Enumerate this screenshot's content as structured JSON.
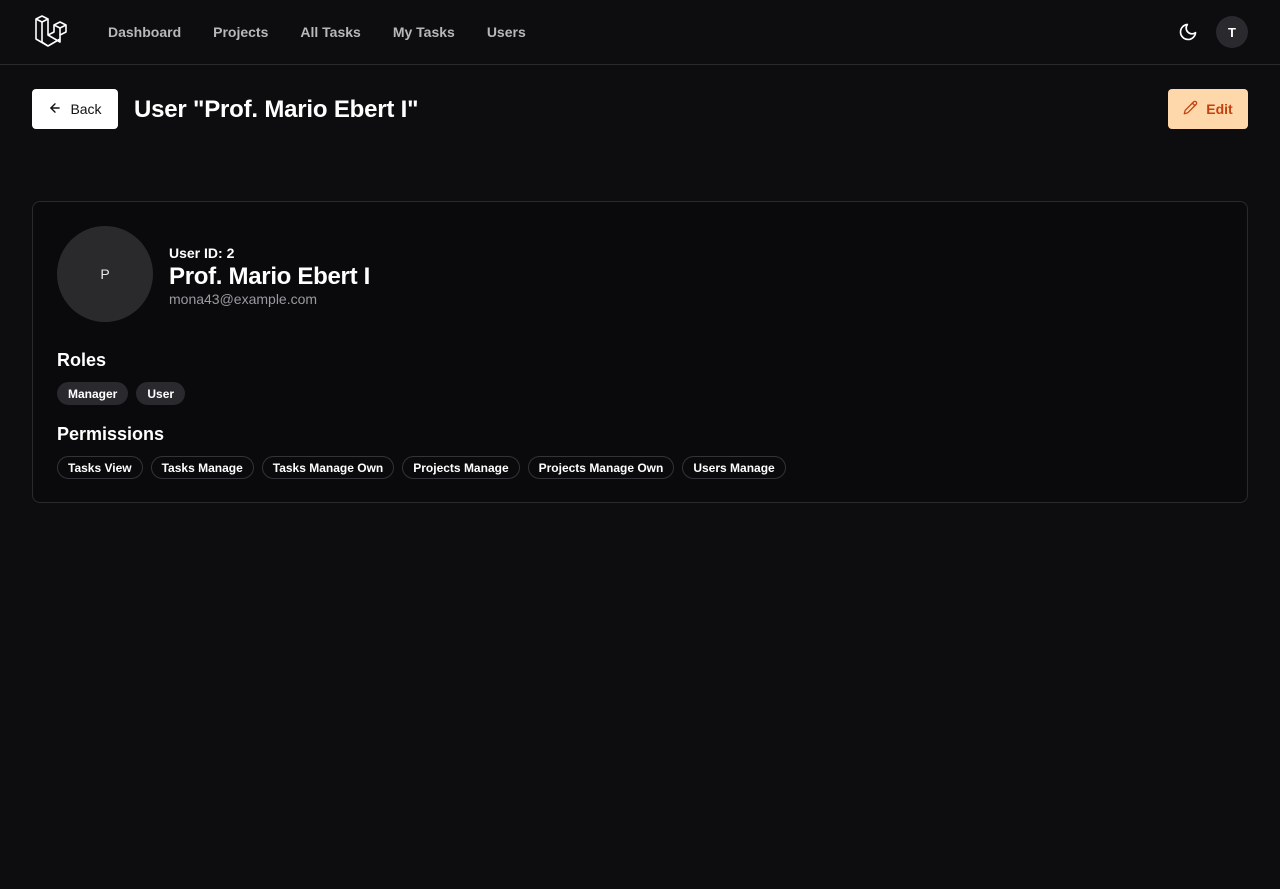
{
  "nav": {
    "items": [
      {
        "label": "Dashboard"
      },
      {
        "label": "Projects"
      },
      {
        "label": "All Tasks"
      },
      {
        "label": "My Tasks"
      },
      {
        "label": "Users"
      }
    ],
    "user_initial": "T",
    "logo_icon": "laravel-logo-icon",
    "theme_icon": "moon-icon"
  },
  "header": {
    "back_label": "Back",
    "title": "User \"Prof. Mario Ebert I\"",
    "edit_label": "Edit"
  },
  "profile": {
    "avatar_initial": "P",
    "user_id_text": "User ID: 2",
    "name": "Prof. Mario Ebert I",
    "email": "mona43@example.com"
  },
  "roles": {
    "title": "Roles",
    "items": [
      "Manager",
      "User"
    ]
  },
  "permissions": {
    "title": "Permissions",
    "items": [
      "Tasks View",
      "Tasks Manage",
      "Tasks Manage Own",
      "Projects Manage",
      "Projects Manage Own",
      "Users Manage"
    ]
  },
  "colors": {
    "background": "#0d0d0f",
    "edit_bg": "#fed7aa",
    "edit_text": "#c2410c"
  }
}
